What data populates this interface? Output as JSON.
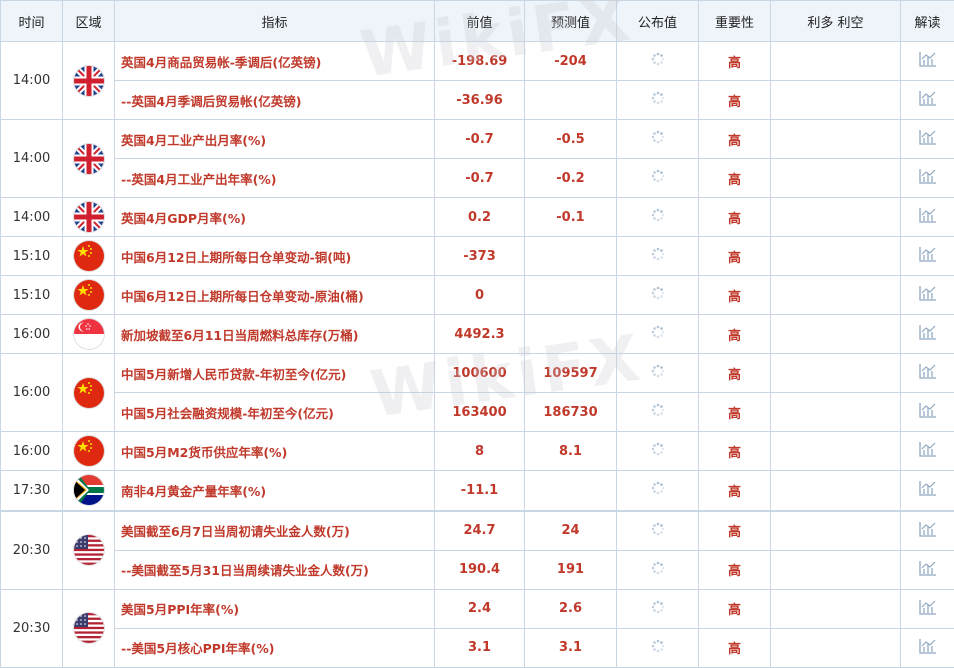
{
  "header": {
    "time": "时间",
    "region": "区域",
    "indicator": "指标",
    "previous": "前值",
    "forecast": "预测值",
    "actual": "公布值",
    "importance": "重要性",
    "impact": "利多 利空",
    "analysis": "解读"
  },
  "watermark": "WikiFX",
  "colors": {
    "accent_red": "#c0392b",
    "header_bg": "#eef4fa",
    "border": "#c9d7e4"
  },
  "rows": [
    {
      "time": "14:00",
      "flag": "uk-flag-icon",
      "indicator": "英国4月商品贸易帐-季调后(亿英镑)",
      "previous": "-198.69",
      "forecast": "-204",
      "importance": "高"
    },
    {
      "time": "",
      "flag": "",
      "indicator": "--英国4月季调后贸易帐(亿英镑)",
      "previous": "-36.96",
      "forecast": "",
      "importance": "高"
    },
    {
      "time": "14:00",
      "flag": "uk-flag-icon",
      "indicator": "英国4月工业产出月率(%)",
      "previous": "-0.7",
      "forecast": "-0.5",
      "importance": "高"
    },
    {
      "time": "",
      "flag": "",
      "indicator": "--英国4月工业产出年率(%)",
      "previous": "-0.7",
      "forecast": "-0.2",
      "importance": "高"
    },
    {
      "time": "14:00",
      "flag": "uk-flag-icon",
      "indicator": "英国4月GDP月率(%)",
      "previous": "0.2",
      "forecast": "-0.1",
      "importance": "高"
    },
    {
      "time": "15:10",
      "flag": "china-flag-icon",
      "indicator": "中国6月12日上期所每日仓单变动-铜(吨)",
      "previous": "-373",
      "forecast": "",
      "importance": "高"
    },
    {
      "time": "15:10",
      "flag": "china-flag-icon",
      "indicator": "中国6月12日上期所每日仓单变动-原油(桶)",
      "previous": "0",
      "forecast": "",
      "importance": "高"
    },
    {
      "time": "16:00",
      "flag": "singapore-flag-icon",
      "indicator": "新加坡截至6月11日当周燃料总库存(万桶)",
      "previous": "4492.3",
      "forecast": "",
      "importance": "高"
    },
    {
      "time": "16:00",
      "flag": "china-flag-icon",
      "indicator": "中国5月新增人民币贷款-年初至今(亿元)",
      "previous": "100600",
      "forecast": "109597",
      "importance": "高"
    },
    {
      "time": "",
      "flag": "",
      "indicator": "中国5月社会融资规模-年初至今(亿元)",
      "previous": "163400",
      "forecast": "186730",
      "importance": "高"
    },
    {
      "time": "16:00",
      "flag": "china-flag-icon",
      "indicator": "中国5月M2货币供应年率(%)",
      "previous": "8",
      "forecast": "8.1",
      "importance": "高"
    },
    {
      "time": "17:30",
      "flag": "south-africa-flag-icon",
      "indicator": "南非4月黄金产量年率(%)",
      "previous": "-11.1",
      "forecast": "",
      "importance": "高"
    },
    {
      "time": "20:30",
      "flag": "us-flag-icon",
      "indicator": "美国截至6月7日当周初请失业金人数(万)",
      "previous": "24.7",
      "forecast": "24",
      "importance": "高"
    },
    {
      "time": "",
      "flag": "",
      "indicator": "--美国截至5月31日当周续请失业金人数(万)",
      "previous": "190.4",
      "forecast": "191",
      "importance": "高"
    },
    {
      "time": "20:30",
      "flag": "us-flag-icon",
      "indicator": "美国5月PPI年率(%)",
      "previous": "2.4",
      "forecast": "2.6",
      "importance": "高"
    },
    {
      "time": "",
      "flag": "",
      "indicator": "--美国5月核心PPI年率(%)",
      "previous": "3.1",
      "forecast": "3.1",
      "importance": "高"
    }
  ]
}
